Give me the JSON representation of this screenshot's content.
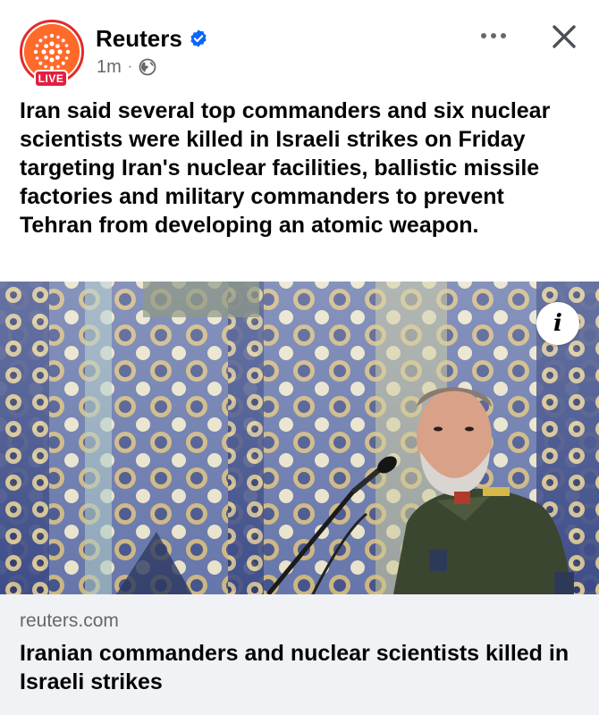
{
  "post": {
    "page_name": "Reuters",
    "live_badge": "LIVE",
    "timestamp": "1m",
    "separator": "·",
    "audience_icon": "globe-icon",
    "verified_icon": "verified-badge-icon",
    "text": "Iran said several top commanders and six nuclear scientists were killed in Israeli strikes on Friday targeting Iran's nuclear facilities, ballistic missile factories and military commanders to prevent Tehran from developing an atomic weapon.",
    "info_label": "i"
  },
  "link": {
    "domain": "reuters.com",
    "title": "Iranian commanders and nuclear scientists killed in Israeli strikes"
  },
  "colors": {
    "brand_orange": "#ff6a2a",
    "live_red": "#e41e3f",
    "verified_blue": "#0866ff",
    "secondary_text": "#65676b",
    "card_bg": "#f0f2f5"
  }
}
